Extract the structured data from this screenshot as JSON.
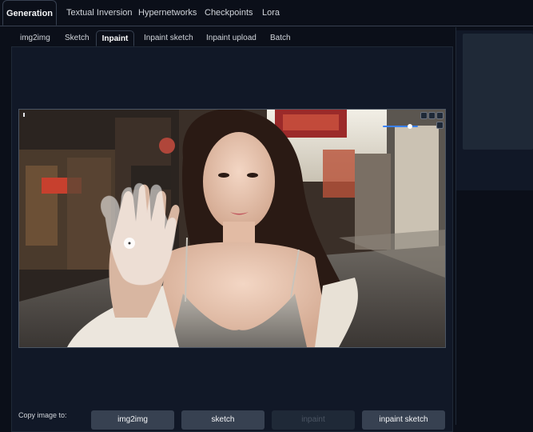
{
  "top_tabs": [
    "Generation",
    "Textual Inversion",
    "Hypernetworks",
    "Checkpoints",
    "Lora"
  ],
  "active_top_tab": "Generation",
  "sub_tabs": [
    "img2img",
    "Sketch",
    "Inpaint",
    "Inpaint sketch",
    "Inpaint upload",
    "Batch"
  ],
  "active_sub_tab": "Inpaint",
  "canvas": {
    "image_subject": "woman-on-city-street-photo",
    "brush_size_fraction": 0.25
  },
  "copy_image": {
    "label": "Copy image to:",
    "buttons": [
      "img2img",
      "sketch",
      "inpaint",
      "inpaint sketch"
    ],
    "disabled": "inpaint"
  },
  "colors": {
    "background": "#0b0f19",
    "panel": "#111827",
    "accent": "#3b82f6"
  }
}
